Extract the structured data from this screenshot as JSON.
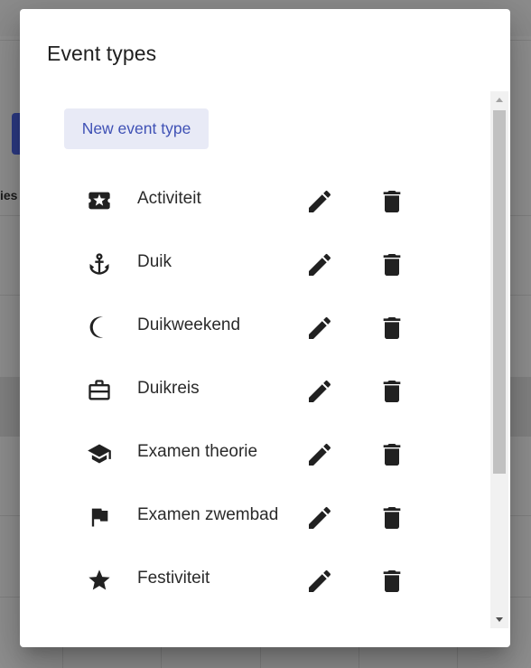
{
  "dialog": {
    "title": "Event types",
    "new_button_label": "New event type"
  },
  "event_types": [
    {
      "label": "Activiteit",
      "icon": "local-activity-icon"
    },
    {
      "label": "Duik",
      "icon": "anchor-icon"
    },
    {
      "label": "Duikweekend",
      "icon": "moon-icon"
    },
    {
      "label": "Duikreis",
      "icon": "luggage-icon"
    },
    {
      "label": "Examen theorie",
      "icon": "graduation-cap-icon"
    },
    {
      "label": "Examen zwembad",
      "icon": "flag-icon"
    },
    {
      "label": "Festiviteit",
      "icon": "star-icon"
    }
  ],
  "background": {
    "partial_text": "ies"
  },
  "colors": {
    "accent": "#3f51b5",
    "accent_bg": "#e8eaf6",
    "icon": "#212121",
    "scrollbar_thumb": "#c1c1c1"
  }
}
